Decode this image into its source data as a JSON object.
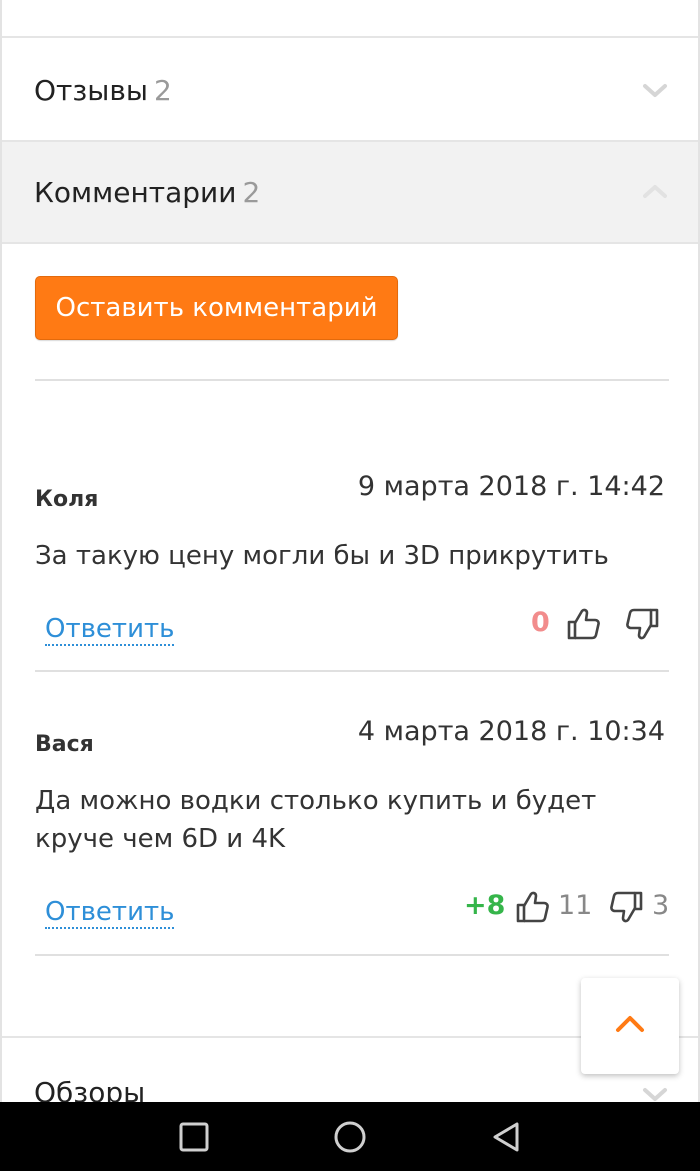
{
  "accordion": {
    "reviews": {
      "label": "Отзывы",
      "count": "2"
    },
    "comments": {
      "label": "Комментарии",
      "count": "2"
    },
    "overviews": {
      "label": "Обзоры"
    }
  },
  "comments_section": {
    "add_button_label": "Оставить комментарий",
    "reply_label": "Ответить",
    "items": [
      {
        "author": "Коля",
        "date": "9 марта 2018 г. 14:42",
        "text": "За такую цену могли бы и 3D прикрутить",
        "score": "0",
        "likes": "",
        "dislikes": ""
      },
      {
        "author": "Вася",
        "date": "4 марта 2018 г. 10:34",
        "text": "Да можно водки столько купить и будет круче чем 6D и 4K",
        "score": "+8",
        "likes": "11",
        "dislikes": "3"
      }
    ]
  },
  "colors": {
    "accent": "#ff7a14",
    "link": "#2e8fd8",
    "score_positive": "#35b54a",
    "score_zero": "#f28c8c"
  },
  "icons": [
    "chevron-down-icon",
    "chevron-up-icon",
    "thumbs-up-icon",
    "thumbs-down-icon",
    "arrow-up-icon",
    "nav-recent-icon",
    "nav-home-icon",
    "nav-back-icon"
  ]
}
